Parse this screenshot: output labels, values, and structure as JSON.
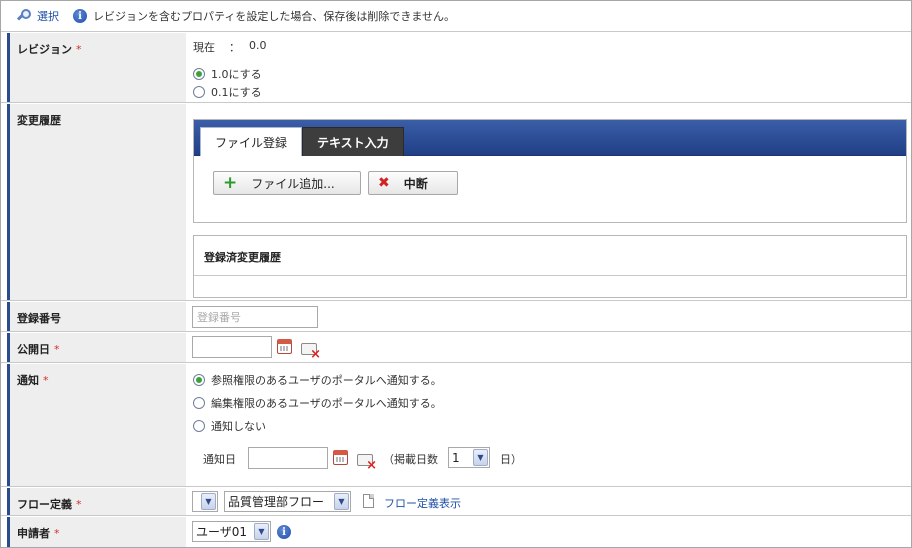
{
  "toolbar": {
    "select_label": "選択",
    "notice": "レビジョンを含むプロパティを設定した場合、保存後は削除できません。"
  },
  "required_mark": "*",
  "revision": {
    "label": "レビジョン",
    "current_label": "現在",
    "separator": "：",
    "current_value": "0.0",
    "options": [
      {
        "label": "1.0にする",
        "selected": true
      },
      {
        "label": "0.1にする",
        "selected": false
      }
    ]
  },
  "history": {
    "label": "変更履歴",
    "tabs": [
      {
        "label": "ファイル登録",
        "active": true
      },
      {
        "label": "テキスト入力",
        "active": false
      }
    ],
    "add_file_label": "ファイル追加...",
    "abort_label": "中断",
    "registered_title": "登録済変更履歴"
  },
  "reg_number": {
    "label": "登録番号",
    "placeholder": "登録番号",
    "value": ""
  },
  "publish_date": {
    "label": "公開日",
    "value": ""
  },
  "notify": {
    "label": "通知",
    "options": [
      {
        "label": "参照権限のあるユーザのポータルへ通知する。",
        "selected": true
      },
      {
        "label": "編集権限のあるユーザのポータルへ通知する。",
        "selected": false
      },
      {
        "label": "通知しない",
        "selected": false
      }
    ],
    "date_label": "通知日",
    "days_prefix": "（掲載日数",
    "days_value": "1",
    "days_suffix": "日）"
  },
  "flow": {
    "label": "フロー定義",
    "category_value": "",
    "flow_value": "品質管理部フロー",
    "view_link": "フロー定義表示"
  },
  "applicant": {
    "label": "申請者",
    "value": "ユーザ01"
  },
  "colors": {
    "accent": "#2c4a8f",
    "link": "#1f4fa8",
    "required": "#d0302a",
    "radio_on": "#3aa23a"
  }
}
